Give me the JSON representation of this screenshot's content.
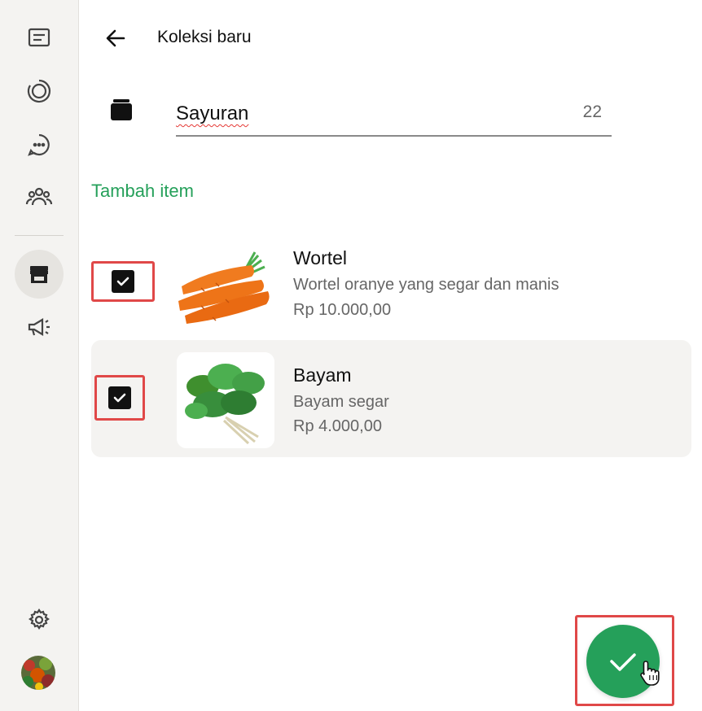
{
  "sidebar": {
    "icons": [
      "chats-icon",
      "status-icon",
      "channels-icon",
      "communities-icon",
      "tools-icon",
      "advertise-icon",
      "settings-icon",
      "profile-avatar"
    ]
  },
  "header": {
    "title": "Koleksi baru"
  },
  "collection": {
    "name": "Sayuran",
    "remaining_chars": "22"
  },
  "add_item_label": "Tambah item",
  "items": [
    {
      "name": "Wortel",
      "description": "Wortel oranye yang segar dan manis",
      "price": "Rp 10.000,00",
      "checked": true
    },
    {
      "name": "Bayam",
      "description": "Bayam segar",
      "price": "Rp 4.000,00",
      "checked": true
    }
  ],
  "colors": {
    "accent": "#25a05a",
    "highlight_frame": "#e04848",
    "sidebar_bg": "#f4f3f1"
  }
}
